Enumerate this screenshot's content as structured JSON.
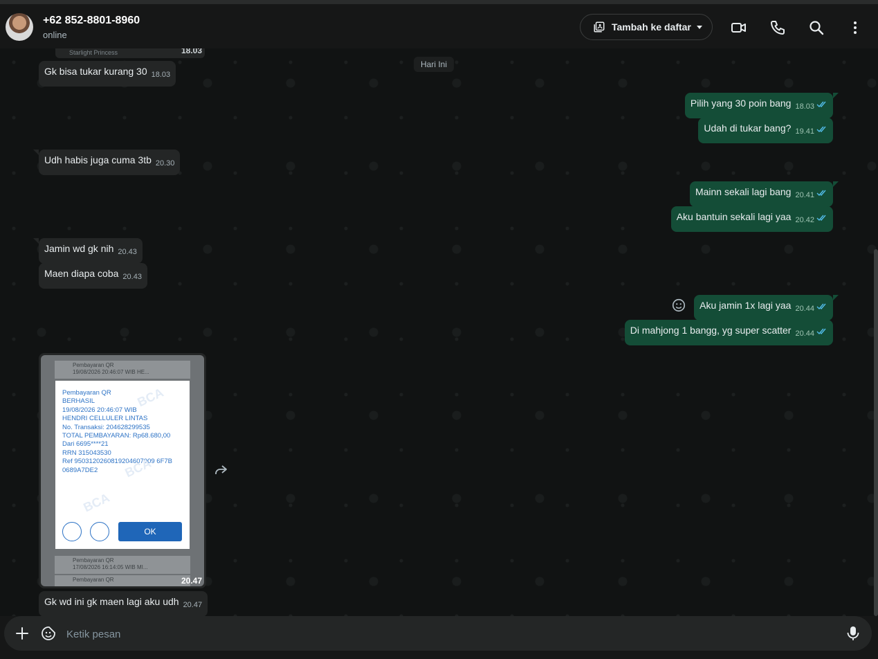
{
  "header": {
    "contact_name": "+62 852-8801-8960",
    "status": "online",
    "add_to_list_label": "Tambah ke daftar",
    "icons": [
      "list-add-icon",
      "video-call-icon",
      "phone-icon",
      "search-icon",
      "more-options-icon"
    ]
  },
  "chat": {
    "date_chip": "Hari Ini",
    "clipped_top": {
      "text": "Starlight Princess",
      "time": "18.03"
    },
    "messages": [
      {
        "dir": "in",
        "text": "Gk bisa tukar kurang 30",
        "time": "18.03"
      },
      {
        "dir": "out",
        "text": "Pilih yang 30 poin bang",
        "time": "18.03"
      },
      {
        "dir": "out",
        "text": "Udah di tukar bang?",
        "time": "19.41"
      },
      {
        "dir": "in",
        "text": "Udh habis juga cuma 3tb",
        "time": "20.30"
      },
      {
        "dir": "out",
        "text": "Mainn sekali lagi bang",
        "time": "20.41"
      },
      {
        "dir": "out",
        "text": "Aku bantuin sekali lagi yaa",
        "time": "20.42"
      },
      {
        "dir": "in",
        "text": "Jamin wd gk nih",
        "time": "20.43"
      },
      {
        "dir": "in",
        "text": "Maen diapa coba",
        "time": "20.43"
      },
      {
        "dir": "out",
        "text": "Aku jamin 1x lagi yaa",
        "time": "20.44"
      },
      {
        "dir": "out",
        "text": "Di mahjong 1 bangg, yg super scatter",
        "time": "20.44"
      },
      {
        "dir": "in",
        "text": "Gk wd ini gk maen lagi aku udh",
        "time": "20.47"
      }
    ],
    "image_message": {
      "time": "20.47",
      "rows_top": [
        {
          "title": "Pembayaran QR",
          "sub": "19/08/2026 20:46:07 WIB HE..."
        }
      ],
      "rows_bottom": [
        {
          "title": "Pembayaran QR",
          "sub": "17/08/2026 16:14:05 WIB MI..."
        },
        {
          "title": "Pembayaran QR",
          "sub": ""
        }
      ],
      "receipt_lines": [
        "Pembayaran QR",
        "BERHASIL",
        "19/08/2026 20:46:07 WIB",
        "HENDRI CELLULER LINTAS",
        "No. Transaksi: 204628299535",
        "TOTAL PEMBAYARAN: Rp68.680,00",
        "Dari 6695****21",
        "RRN 315043530",
        "Ref 9503120260819204607009 6F7B",
        "0689A7DE2"
      ],
      "watermark": "BCA",
      "ok_label": "OK"
    }
  },
  "composer": {
    "placeholder": "Ketik pesan"
  }
}
